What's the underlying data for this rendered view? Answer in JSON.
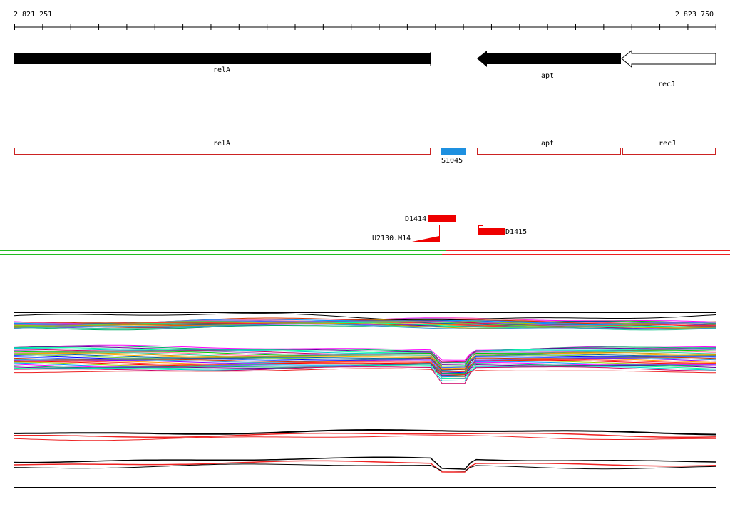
{
  "ruler": {
    "start_label": "2 821 251",
    "end_label": "2 823 750",
    "start": 2821251,
    "end": 2823750
  },
  "genes_arrow_track": [
    {
      "name": "relA",
      "strand": "+",
      "style": "filled"
    },
    {
      "name": "apt",
      "strand": "-",
      "style": "filled"
    },
    {
      "name": "recJ",
      "strand": "-",
      "style": "outline"
    }
  ],
  "genes_box_track": [
    {
      "name": "relA"
    },
    {
      "name": "apt"
    },
    {
      "name": "recJ"
    }
  ],
  "feature_labels": {
    "blue_feature": "S1045",
    "d1414": "D1414",
    "d1415": "D1415",
    "u2130": "U2130.M14"
  },
  "colors": {
    "gene_fill": "#000000",
    "gene_box_outline": "#cc2222",
    "blue_feature": "#1e90e0",
    "red_feature": "#ee0000",
    "track_green": "#22bb22",
    "track_red": "#ee2222"
  }
}
